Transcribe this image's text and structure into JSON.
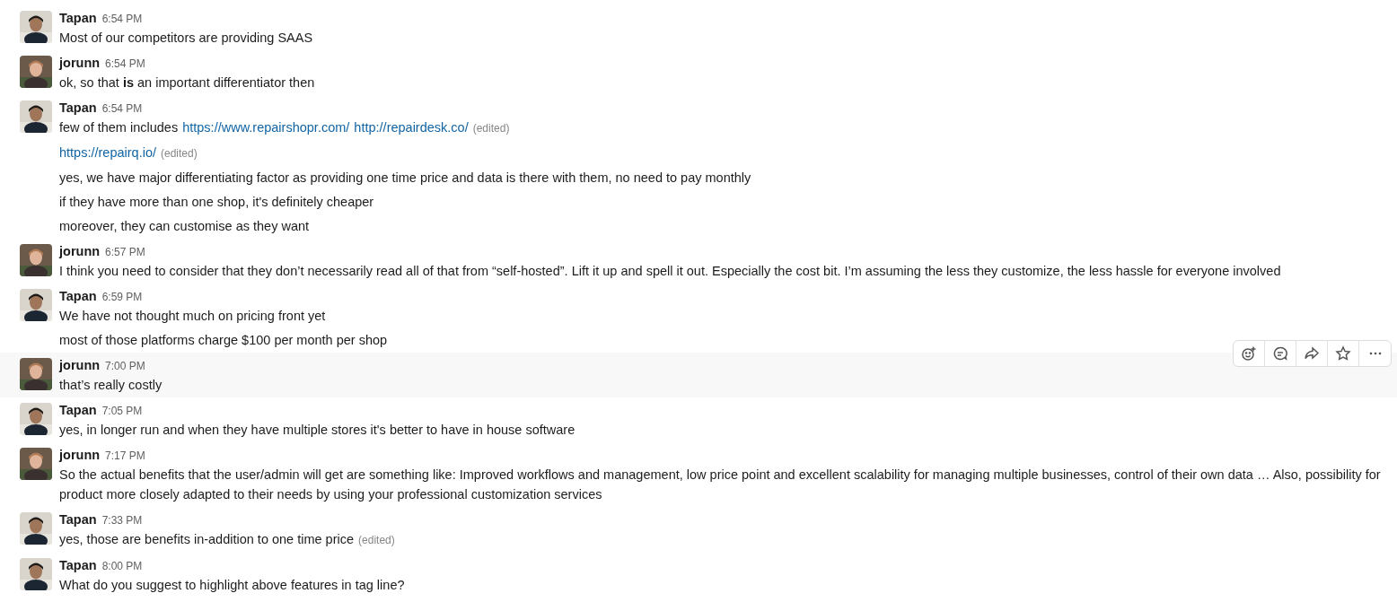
{
  "messages": [
    {
      "author": "Tapan",
      "time": "6:54 PM",
      "avatar": {
        "kind": "picture",
        "color": "#d9d4cc"
      },
      "hovered": false,
      "lines": [
        {
          "parts": [
            {
              "kind": "text",
              "text": "Most of our competitors are providing SAAS"
            }
          ]
        }
      ]
    },
    {
      "author": "jorunn",
      "time": "6:54 PM",
      "avatar": {
        "kind": "picture",
        "color": "#6b5a4a"
      },
      "hovered": false,
      "lines": [
        {
          "parts": [
            {
              "kind": "text",
              "text": "ok, so that **is** an important differentiator then"
            }
          ]
        }
      ]
    },
    {
      "author": "Tapan",
      "time": "6:54 PM",
      "avatar": {
        "kind": "picture",
        "color": "#d9d4cc"
      },
      "hovered": false,
      "lines": [
        {
          "parts": [
            {
              "kind": "text",
              "text": "few of them includes"
            },
            {
              "kind": "link",
              "text": "https://www.repairshopr.com/"
            },
            {
              "kind": "link",
              "text": "http://repairdesk.co/"
            },
            {
              "kind": "edited",
              "text": "(edited)"
            }
          ]
        },
        {
          "parts": [
            {
              "kind": "link",
              "text": "https://repairq.io/"
            },
            {
              "kind": "edited",
              "text": "(edited)"
            }
          ]
        },
        {
          "parts": [
            {
              "kind": "text",
              "text": "yes, we have major differentiating factor as providing one time price and data is there with them, no need to pay monthly"
            }
          ]
        },
        {
          "parts": [
            {
              "kind": "text",
              "text": "if they have more than one shop, it's definitely cheaper"
            }
          ]
        },
        {
          "parts": [
            {
              "kind": "text",
              "text": "moreover, they can customise as they want"
            }
          ]
        }
      ]
    },
    {
      "author": "jorunn",
      "time": "6:57 PM",
      "avatar": {
        "kind": "picture",
        "color": "#6b5a4a"
      },
      "hovered": false,
      "lines": [
        {
          "parts": [
            {
              "kind": "text",
              "text": "I think you need to consider that they don’t necessarily read all of that from “self-hosted”. Lift it up and spell it out. Especially the cost bit. I’m assuming the less they customize, the less hassle for everyone involved"
            }
          ]
        }
      ]
    },
    {
      "author": "Tapan",
      "time": "6:59 PM",
      "avatar": {
        "kind": "picture",
        "color": "#d9d4cc"
      },
      "hovered": false,
      "lines": [
        {
          "parts": [
            {
              "kind": "text",
              "text": "We have not thought much on pricing front yet"
            }
          ]
        },
        {
          "parts": [
            {
              "kind": "text",
              "text": "most of those platforms charge $100 per month per shop"
            }
          ]
        }
      ]
    },
    {
      "author": "jorunn",
      "time": "7:00 PM",
      "avatar": {
        "kind": "picture",
        "color": "#6b5a4a"
      },
      "hovered": true,
      "lines": [
        {
          "parts": [
            {
              "kind": "text",
              "text": "that’s really costly"
            }
          ]
        }
      ]
    },
    {
      "author": "Tapan",
      "time": "7:05 PM",
      "avatar": {
        "kind": "picture",
        "color": "#d9d4cc"
      },
      "hovered": false,
      "lines": [
        {
          "parts": [
            {
              "kind": "text",
              "text": "yes, in longer run and when they have multiple stores it's better to have in house software"
            }
          ]
        }
      ]
    },
    {
      "author": "jorunn",
      "time": "7:17 PM",
      "avatar": {
        "kind": "picture",
        "color": "#6b5a4a"
      },
      "hovered": false,
      "lines": [
        {
          "parts": [
            {
              "kind": "text",
              "text": "So the actual benefits that the user/admin will get are something like: Improved workflows and management, low price point and excellent scalability for managing multiple businesses, control of their own data … Also, possibility for product more closely adapted to their needs by using your professional customization services"
            }
          ]
        }
      ]
    },
    {
      "author": "Tapan",
      "time": "7:33 PM",
      "avatar": {
        "kind": "picture",
        "color": "#d9d4cc"
      },
      "hovered": false,
      "lines": [
        {
          "parts": [
            {
              "kind": "text",
              "text": "yes, those are benefits in-addition to one time price"
            },
            {
              "kind": "edited",
              "text": "(edited)"
            }
          ]
        }
      ]
    },
    {
      "author": "Tapan",
      "time": "8:00 PM",
      "avatar": {
        "kind": "picture",
        "color": "#d9d4cc"
      },
      "hovered": false,
      "lines": [
        {
          "parts": [
            {
              "kind": "text",
              "text": "What do you suggest to highlight above features in tag line?"
            }
          ]
        }
      ]
    }
  ]
}
